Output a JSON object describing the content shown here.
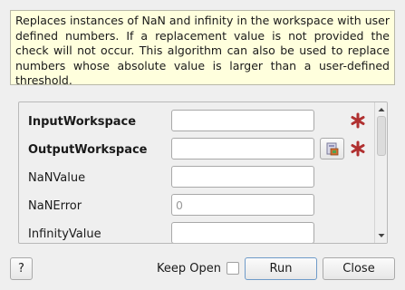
{
  "description": "Replaces instances of NaN and infinity in the workspace with user defined numbers. If a replacement value is not provided the check will not occur. This algorithm can also be used to replace numbers whose absolute value is larger than a user-defined threshold.",
  "properties": [
    {
      "label": "InputWorkspace",
      "value": "",
      "placeholder": "",
      "required": true,
      "browse": false
    },
    {
      "label": "OutputWorkspace",
      "value": "",
      "placeholder": "",
      "required": true,
      "browse": true
    },
    {
      "label": "NaNValue",
      "value": "",
      "placeholder": "",
      "required": false,
      "browse": false
    },
    {
      "label": "NaNError",
      "value": "",
      "placeholder": "0",
      "required": false,
      "browse": false
    },
    {
      "label": "InfinityValue",
      "value": "",
      "placeholder": "",
      "required": false,
      "browse": false
    }
  ],
  "footer": {
    "help_label": "?",
    "keep_open_label": "Keep Open",
    "keep_open_checked": false,
    "run_label": "Run",
    "close_label": "Close"
  },
  "colors": {
    "required_asterisk": "#b03030",
    "description_bg": "#ffffdd"
  }
}
